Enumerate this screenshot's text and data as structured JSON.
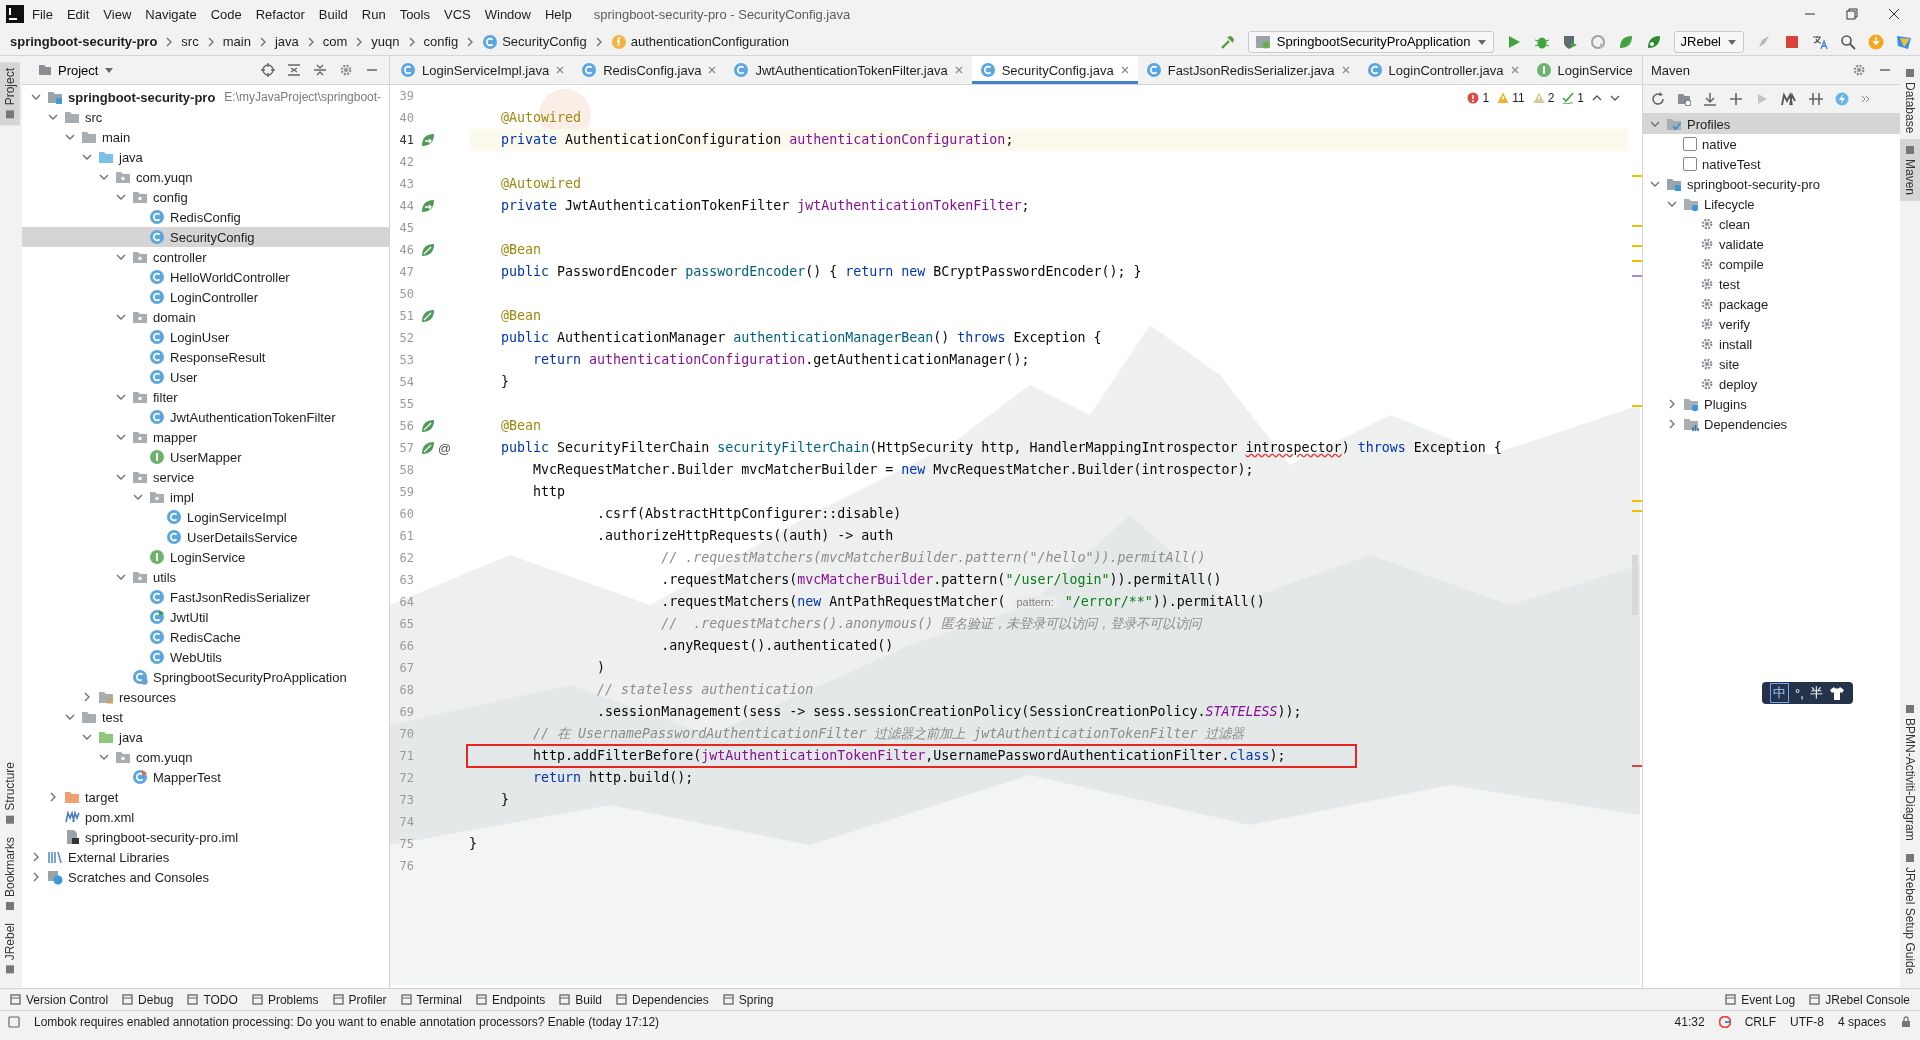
{
  "menu": [
    "File",
    "Edit",
    "View",
    "Navigate",
    "Code",
    "Refactor",
    "Build",
    "Run",
    "Tools",
    "VCS",
    "Window",
    "Help"
  ],
  "window": {
    "title": "springboot-security-pro - SecurityConfig.java"
  },
  "breadcrumbs": [
    {
      "label": "springboot-security-pro",
      "kind": "project"
    },
    {
      "label": "src",
      "kind": "plain"
    },
    {
      "label": "main",
      "kind": "plain"
    },
    {
      "label": "java",
      "kind": "plain"
    },
    {
      "label": "com",
      "kind": "plain"
    },
    {
      "label": "yuqn",
      "kind": "plain"
    },
    {
      "label": "config",
      "kind": "plain"
    },
    {
      "label": "SecurityConfig",
      "kind": "class"
    },
    {
      "label": "authenticationConfiguration",
      "kind": "field"
    }
  ],
  "run_config": {
    "label": "SpringbootSecurityProApplication"
  },
  "jrebel": {
    "label": "JRebel"
  },
  "left_strip": {
    "top": [
      {
        "label": "Project",
        "selected": true
      }
    ],
    "bottom": [
      {
        "label": "Structure",
        "selected": false
      },
      {
        "label": "Bookmarks",
        "selected": false
      },
      {
        "label": "JRebel",
        "selected": false
      }
    ]
  },
  "right_strip": {
    "top": [
      {
        "label": "Database",
        "selected": false
      },
      {
        "label": "Maven",
        "selected": true
      }
    ],
    "bottom": [
      {
        "label": "BPMN-Activiti-Diagram",
        "selected": false
      },
      {
        "label": "JRebel Setup Guide",
        "selected": false
      }
    ]
  },
  "project_panel": {
    "title": "Project",
    "tree": [
      {
        "label": "springboot-security-pro",
        "path": "E:\\myJavaProject\\springboot-",
        "kind": "module",
        "expanded": true,
        "selected": false,
        "children": [
          {
            "label": "src",
            "kind": "folder",
            "expanded": true,
            "selected": false,
            "children": [
              {
                "label": "main",
                "kind": "folder",
                "expanded": true,
                "selected": false,
                "children": [
                  {
                    "label": "java",
                    "kind": "source",
                    "expanded": true,
                    "selected": false,
                    "children": [
                      {
                        "label": "com.yuqn",
                        "kind": "package",
                        "expanded": true,
                        "selected": false,
                        "children": [
                          {
                            "label": "config",
                            "kind": "package",
                            "expanded": true,
                            "selected": false,
                            "children": [
                              {
                                "label": "RedisConfig",
                                "kind": "class",
                                "selected": false
                              },
                              {
                                "label": "SecurityConfig",
                                "kind": "class",
                                "selected": true
                              }
                            ]
                          },
                          {
                            "label": "controller",
                            "kind": "package",
                            "expanded": true,
                            "selected": false,
                            "children": [
                              {
                                "label": "HelloWorldController",
                                "kind": "class",
                                "selected": false
                              },
                              {
                                "label": "LoginController",
                                "kind": "class",
                                "selected": false
                              }
                            ]
                          },
                          {
                            "label": "domain",
                            "kind": "package",
                            "expanded": true,
                            "selected": false,
                            "children": [
                              {
                                "label": "LoginUser",
                                "kind": "class",
                                "selected": false
                              },
                              {
                                "label": "ResponseResult",
                                "kind": "class",
                                "selected": false
                              },
                              {
                                "label": "User",
                                "kind": "class",
                                "selected": false
                              }
                            ]
                          },
                          {
                            "label": "filter",
                            "kind": "package",
                            "expanded": true,
                            "selected": false,
                            "children": [
                              {
                                "label": "JwtAuthenticationTokenFilter",
                                "kind": "class",
                                "selected": false
                              }
                            ]
                          },
                          {
                            "label": "mapper",
                            "kind": "package",
                            "expanded": true,
                            "selected": false,
                            "children": [
                              {
                                "label": "UserMapper",
                                "kind": "interface",
                                "selected": false
                              }
                            ]
                          },
                          {
                            "label": "service",
                            "kind": "package",
                            "expanded": true,
                            "selected": false,
                            "children": [
                              {
                                "label": "impl",
                                "kind": "package",
                                "expanded": true,
                                "selected": false,
                                "children": [
                                  {
                                    "label": "LoginServiceImpl",
                                    "kind": "class",
                                    "selected": false
                                  },
                                  {
                                    "label": "UserDetailsService",
                                    "kind": "class",
                                    "selected": false
                                  }
                                ]
                              },
                              {
                                "label": "LoginService",
                                "kind": "interface",
                                "selected": false
                              }
                            ]
                          },
                          {
                            "label": "utils",
                            "kind": "package",
                            "expanded": true,
                            "selected": false,
                            "children": [
                              {
                                "label": "FastJsonRedisSerializer",
                                "kind": "class",
                                "selected": false
                              },
                              {
                                "label": "JwtUtil",
                                "kind": "runnable-class",
                                "selected": false
                              },
                              {
                                "label": "RedisCache",
                                "kind": "class",
                                "selected": false
                              },
                              {
                                "label": "WebUtils",
                                "kind": "class",
                                "selected": false
                              }
                            ]
                          },
                          {
                            "label": "SpringbootSecurityProApplication",
                            "kind": "app-class",
                            "selected": false
                          }
                        ]
                      }
                    ]
                  },
                  {
                    "label": "resources",
                    "kind": "resources",
                    "expanded": false,
                    "selected": false
                  }
                ]
              },
              {
                "label": "test",
                "kind": "folder",
                "expanded": true,
                "selected": false,
                "children": [
                  {
                    "label": "java",
                    "kind": "test-source",
                    "expanded": true,
                    "selected": false,
                    "children": [
                      {
                        "label": "com.yuqn",
                        "kind": "package",
                        "expanded": true,
                        "selected": false,
                        "children": [
                          {
                            "label": "MapperTest",
                            "kind": "test-class",
                            "selected": false
                          }
                        ]
                      }
                    ]
                  }
                ]
              }
            ]
          },
          {
            "label": "target",
            "kind": "excluded",
            "expanded": false,
            "selected": false
          },
          {
            "label": "pom.xml",
            "kind": "maven-file",
            "selected": false
          },
          {
            "label": "springboot-security-pro.iml",
            "kind": "iml",
            "selected": false
          }
        ]
      },
      {
        "label": "External Libraries",
        "kind": "libraries",
        "expanded": false,
        "selected": false
      },
      {
        "label": "Scratches and Consoles",
        "kind": "scratches",
        "expanded": false,
        "selected": false
      }
    ]
  },
  "tabs": [
    {
      "label": "LoginServiceImpl.java",
      "kind": "class",
      "selected": false,
      "closable": true
    },
    {
      "label": "RedisConfig.java",
      "kind": "class",
      "selected": false,
      "closable": true
    },
    {
      "label": "JwtAuthenticationTokenFilter.java",
      "kind": "class",
      "selected": false,
      "closable": true
    },
    {
      "label": "SecurityConfig.java",
      "kind": "class",
      "selected": true,
      "closable": true
    },
    {
      "label": "FastJsonRedisSerializer.java",
      "kind": "class",
      "selected": false,
      "closable": true
    },
    {
      "label": "LoginController.java",
      "kind": "class",
      "selected": false,
      "closable": true
    },
    {
      "label": "LoginService",
      "kind": "interface",
      "selected": false,
      "closable": false
    }
  ],
  "editor": {
    "inspections": {
      "errors": "1",
      "warnings": "11",
      "weak_warnings": "2",
      "typos": "1"
    },
    "lines": [
      {
        "number": "39",
        "current": false
      },
      {
        "number": "40",
        "current": false,
        "tokens": [
          {
            "kind": "annotation",
            "text": "    @Autowired"
          }
        ]
      },
      {
        "number": "41",
        "current": true,
        "gutter": {
          "kind": "bean-ref"
        },
        "tokens": [
          {
            "kind": "keyword",
            "text": "    private"
          },
          {
            "kind": "plain",
            "text": " AuthenticationConfiguration "
          },
          {
            "kind": "field",
            "text": "authenticationConfiguration"
          },
          {
            "kind": "plain",
            "text": ";"
          }
        ]
      },
      {
        "number": "42",
        "current": false
      },
      {
        "number": "43",
        "current": false,
        "tokens": [
          {
            "kind": "annotation",
            "text": "    @Autowired"
          }
        ]
      },
      {
        "number": "44",
        "current": false,
        "gutter": {
          "kind": "bean-ref"
        },
        "tokens": [
          {
            "kind": "keyword",
            "text": "    private"
          },
          {
            "kind": "plain",
            "text": " JwtAuthenticationTokenFilter "
          },
          {
            "kind": "field",
            "text": "jwtAuthenticationTokenFilter"
          },
          {
            "kind": "plain",
            "text": ";"
          }
        ]
      },
      {
        "number": "45",
        "current": false
      },
      {
        "number": "46",
        "current": false,
        "gutter": {
          "kind": "bean"
        },
        "tokens": [
          {
            "kind": "annotation",
            "text": "    @Bean"
          }
        ]
      },
      {
        "number": "47",
        "current": false,
        "tokens": [
          {
            "kind": "keyword",
            "text": "    public"
          },
          {
            "kind": "plain",
            "text": " PasswordEncoder "
          },
          {
            "kind": "method",
            "text": "passwordEncoder"
          },
          {
            "kind": "plain",
            "text": "() { "
          },
          {
            "kind": "keyword",
            "text": "return new"
          },
          {
            "kind": "plain",
            "text": " BCryptPasswordEncoder(); }"
          }
        ]
      },
      {
        "number": "50",
        "current": false
      },
      {
        "number": "51",
        "current": false,
        "gutter": {
          "kind": "bean"
        },
        "tokens": [
          {
            "kind": "annotation",
            "text": "    @Bean"
          }
        ]
      },
      {
        "number": "52",
        "current": false,
        "tokens": [
          {
            "kind": "keyword",
            "text": "    public"
          },
          {
            "kind": "plain",
            "text": " AuthenticationManager "
          },
          {
            "kind": "method",
            "text": "authenticationManagerBean"
          },
          {
            "kind": "plain",
            "text": "() "
          },
          {
            "kind": "keyword",
            "text": "throws"
          },
          {
            "kind": "plain",
            "text": " Exception {"
          }
        ]
      },
      {
        "number": "53",
        "current": false,
        "tokens": [
          {
            "kind": "keyword",
            "text": "        return "
          },
          {
            "kind": "field",
            "text": "authenticationConfiguration"
          },
          {
            "kind": "plain",
            "text": ".getAuthenticationManager();"
          }
        ]
      },
      {
        "number": "54",
        "current": false,
        "tokens": [
          {
            "kind": "plain",
            "text": "    }"
          }
        ]
      },
      {
        "number": "55",
        "current": false
      },
      {
        "number": "56",
        "current": false,
        "gutter": {
          "kind": "bean"
        },
        "tokens": [
          {
            "kind": "annotation",
            "text": "    @Bean"
          }
        ]
      },
      {
        "number": "57",
        "current": false,
        "gutter": {
          "kind": "bean",
          "text": "@"
        },
        "tokens": [
          {
            "kind": "keyword",
            "text": "    public"
          },
          {
            "kind": "plain",
            "text": " SecurityFilterChain "
          },
          {
            "kind": "method",
            "text": "securityFilterChain"
          },
          {
            "kind": "plain",
            "text": "(HttpSecurity http, HandlerMappingIntrospector "
          },
          {
            "kind": "typo",
            "text": "introspector"
          },
          {
            "kind": "plain",
            "text": ") "
          },
          {
            "kind": "keyword",
            "text": "throws"
          },
          {
            "kind": "plain",
            "text": " Exception {"
          }
        ]
      },
      {
        "number": "58",
        "current": false,
        "tokens": [
          {
            "kind": "plain",
            "text": "        MvcRequestMatcher.Builder mvcMatcherBuilder = "
          },
          {
            "kind": "keyword",
            "text": "new"
          },
          {
            "kind": "plain",
            "text": " MvcRequestMatcher.Builder(introspector);"
          }
        ]
      },
      {
        "number": "59",
        "current": false,
        "tokens": [
          {
            "kind": "plain",
            "text": "        http"
          }
        ]
      },
      {
        "number": "60",
        "current": false,
        "tokens": [
          {
            "kind": "plain",
            "text": "                .csrf(AbstractHttpConfigurer::disable)"
          }
        ]
      },
      {
        "number": "61",
        "current": false,
        "tokens": [
          {
            "kind": "plain",
            "text": "                .authorizeHttpRequests((auth) -> auth"
          }
        ]
      },
      {
        "number": "62",
        "current": false,
        "tokens": [
          {
            "kind": "comment",
            "text": "                        // .requestMatchers(mvcMatcherBuilder.pattern(\"/hello\")).permitAll()"
          }
        ]
      },
      {
        "number": "63",
        "current": false,
        "tokens": [
          {
            "kind": "plain",
            "text": "                        .requestMatchers("
          },
          {
            "kind": "field",
            "text": "mvcMatcherBuilder"
          },
          {
            "kind": "plain",
            "text": ".pattern("
          },
          {
            "kind": "string",
            "text": "\"/user/login\""
          },
          {
            "kind": "plain",
            "text": ")).permitAll()"
          }
        ]
      },
      {
        "number": "64",
        "current": false,
        "tokens": [
          {
            "kind": "plain",
            "text": "                        .requestMatchers("
          },
          {
            "kind": "keyword",
            "text": "new"
          },
          {
            "kind": "plain",
            "text": " AntPathRequestMatcher( "
          },
          {
            "kind": "hint",
            "text": "pattern:"
          },
          {
            "kind": "string",
            "text": " \"/error/**\""
          },
          {
            "kind": "plain",
            "text": ")).permitAll()"
          }
        ]
      },
      {
        "number": "65",
        "current": false,
        "tokens": [
          {
            "kind": "comment",
            "text": "                        //  .requestMatchers().anonymous() 匿名验证，未登录可以访问，登录不可以访问"
          }
        ]
      },
      {
        "number": "66",
        "current": false,
        "tokens": [
          {
            "kind": "plain",
            "text": "                        .anyRequest().authenticated()"
          }
        ]
      },
      {
        "number": "67",
        "current": false,
        "tokens": [
          {
            "kind": "plain",
            "text": "                )"
          }
        ]
      },
      {
        "number": "68",
        "current": false,
        "tokens": [
          {
            "kind": "comment",
            "text": "                // stateless authentication"
          }
        ]
      },
      {
        "number": "69",
        "current": false,
        "tokens": [
          {
            "kind": "plain",
            "text": "                .sessionManagement(sess -> sess.sessionCreationPolicy(SessionCreationPolicy."
          },
          {
            "kind": "static",
            "text": "STATELESS"
          },
          {
            "kind": "plain",
            "text": "));"
          }
        ]
      },
      {
        "number": "70",
        "current": false,
        "tokens": [
          {
            "kind": "comment",
            "text": "        // 在 UsernamePasswordAuthenticationFilter 过滤器之前加上 jwtAuthenticationTokenFilter 过滤器"
          }
        ]
      },
      {
        "number": "71",
        "current": false,
        "boxed": true,
        "tokens": [
          {
            "kind": "plain",
            "text": "        http.addFilterBefore("
          },
          {
            "kind": "field",
            "text": "jwtAuthenticationTokenFilter"
          },
          {
            "kind": "plain",
            "text": ",UsernamePasswordAuthenticationFilter."
          },
          {
            "kind": "keyword",
            "text": "class"
          },
          {
            "kind": "plain",
            "text": ");"
          }
        ]
      },
      {
        "number": "72",
        "current": false,
        "tokens": [
          {
            "kind": "keyword",
            "text": "        return"
          },
          {
            "kind": "plain",
            "text": " http.build();"
          }
        ]
      },
      {
        "number": "73",
        "current": false,
        "tokens": [
          {
            "kind": "plain",
            "text": "    }"
          }
        ]
      },
      {
        "number": "74",
        "current": false
      },
      {
        "number": "75",
        "current": false,
        "tokens": [
          {
            "kind": "plain",
            "text": "}"
          }
        ]
      },
      {
        "number": "76",
        "current": false
      }
    ]
  },
  "maven": {
    "title": "Maven",
    "tree": [
      {
        "label": "Profiles",
        "kind": "profiles",
        "expanded": true,
        "selected": true,
        "children": [
          {
            "label": "native",
            "kind": "profile",
            "checked": false,
            "selected": false
          },
          {
            "label": "nativeTest",
            "kind": "profile",
            "checked": false,
            "selected": false
          }
        ]
      },
      {
        "label": "springboot-security-pro",
        "kind": "module",
        "expanded": true,
        "selected": false,
        "children": [
          {
            "label": "Lifecycle",
            "kind": "lifecycle",
            "expanded": true,
            "selected": false,
            "children": [
              {
                "label": "clean",
                "kind": "goal",
                "selected": false
              },
              {
                "label": "validate",
                "kind": "goal",
                "selected": false
              },
              {
                "label": "compile",
                "kind": "goal",
                "selected": false
              },
              {
                "label": "test",
                "kind": "goal",
                "selected": false
              },
              {
                "label": "package",
                "kind": "goal",
                "selected": false
              },
              {
                "label": "verify",
                "kind": "goal",
                "selected": false
              },
              {
                "label": "install",
                "kind": "goal",
                "selected": false
              },
              {
                "label": "site",
                "kind": "goal",
                "selected": false
              },
              {
                "label": "deploy",
                "kind": "goal",
                "selected": false
              }
            ]
          },
          {
            "label": "Plugins",
            "kind": "plugins",
            "expanded": false,
            "selected": false
          },
          {
            "label": "Dependencies",
            "kind": "dependencies",
            "expanded": false,
            "selected": false
          }
        ]
      }
    ]
  },
  "ime": {
    "mode": "中",
    "punctuation": "°,",
    "width": "半"
  },
  "tool_windows": {
    "left": [
      "Version Control",
      "Debug",
      "TODO",
      "Problems",
      "Profiler",
      "Terminal",
      "Endpoints",
      "Build",
      "Dependencies",
      "Spring"
    ],
    "right": [
      "Event Log",
      "JRebel Console"
    ]
  },
  "status": {
    "message": "Lombok requires enabled annotation processing: Do you want to enable annotation processors? Enable (today 17:12)",
    "position": "41:32",
    "line_separator": "CRLF",
    "encoding": "UTF-8",
    "indent": "4 spaces"
  }
}
